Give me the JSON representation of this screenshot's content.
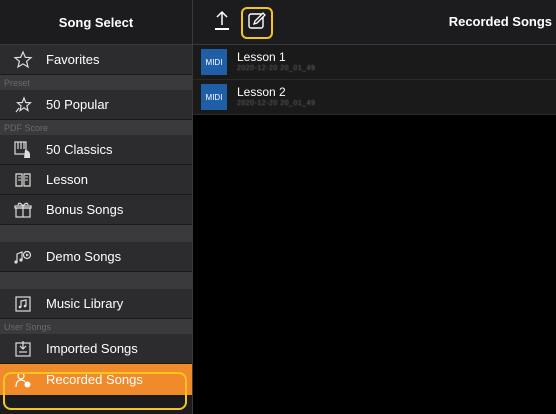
{
  "sidebar": {
    "title": "Song Select",
    "favorites": "Favorites",
    "preset_section": "Preset",
    "popular": "50 Popular",
    "pdf_section": "PDF Score",
    "classics": "50 Classics",
    "lesson": "Lesson",
    "bonus": "Bonus Songs",
    "demo": "Demo Songs",
    "music_library": "Music Library",
    "user_section": "User Songs",
    "imported": "Imported Songs",
    "recorded": "Recorded Songs"
  },
  "main": {
    "title": "Recorded Songs",
    "songs": [
      {
        "badge": "MIDI",
        "name": "Lesson 1",
        "date": "2020-12-20 20_01_49"
      },
      {
        "badge": "MIDI",
        "name": "Lesson 2",
        "date": "2020-12-20 20_01_49"
      }
    ]
  },
  "colors": {
    "accent": "#f08a2a",
    "highlight": "#f3c61e",
    "midi_badge": "#1f5fa8"
  }
}
